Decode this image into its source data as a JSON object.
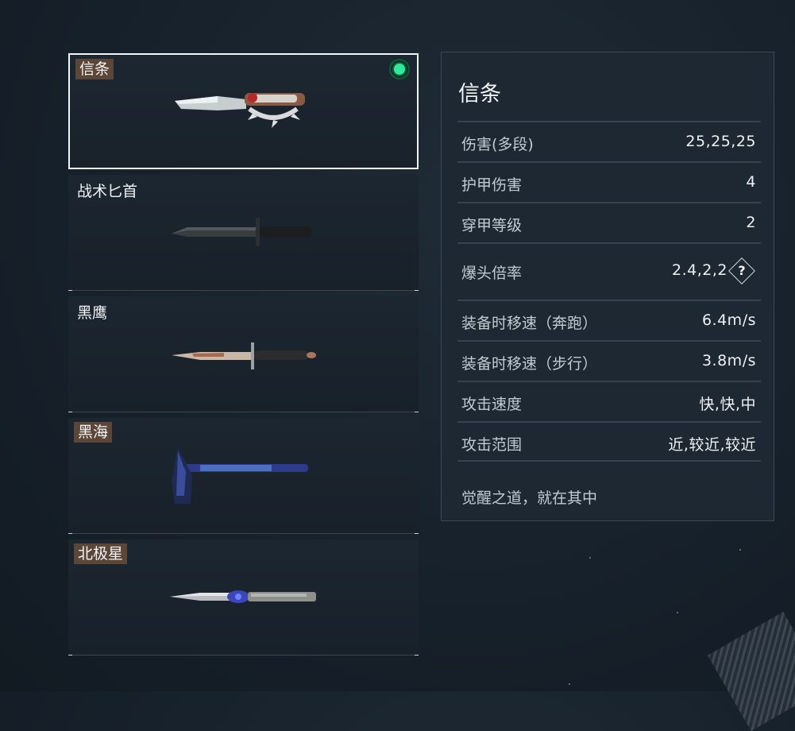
{
  "weapons": [
    {
      "name": "信条",
      "tagged": true,
      "selected": true,
      "equipped": true,
      "icon": "creed-knuckle-knife-icon"
    },
    {
      "name": "战术匕首",
      "tagged": false,
      "selected": false,
      "equipped": false,
      "icon": "tactical-dagger-icon"
    },
    {
      "name": "黑鹰",
      "tagged": false,
      "selected": false,
      "equipped": false,
      "icon": "black-hawk-dagger-icon"
    },
    {
      "name": "黑海",
      "tagged": true,
      "selected": false,
      "equipped": false,
      "icon": "black-sea-axe-icon"
    },
    {
      "name": "北极星",
      "tagged": true,
      "selected": false,
      "equipped": false,
      "icon": "polaris-knife-icon"
    }
  ],
  "stats": {
    "title": "信条",
    "rows": [
      {
        "label": "伤害(多段)",
        "value": "25,25,25"
      },
      {
        "label": "护甲伤害",
        "value": "4"
      },
      {
        "label": "穿甲等级",
        "value": "2"
      },
      {
        "label": "爆头倍率",
        "value": "2.4,2,2",
        "help": "?"
      },
      {
        "label": "装备时移速（奔跑）",
        "value": "6.4m/s"
      },
      {
        "label": "装备时移速（步行）",
        "value": "3.8m/s"
      },
      {
        "label": "攻击速度",
        "value": "快,快,中"
      },
      {
        "label": "攻击范围",
        "value": "近,较近,较近"
      }
    ],
    "description": "觉醒之道，就在其中"
  },
  "colors": {
    "equipped": "#2fe89a",
    "tag_bg": "#5b4638",
    "panel_bg": "#1d2832"
  }
}
